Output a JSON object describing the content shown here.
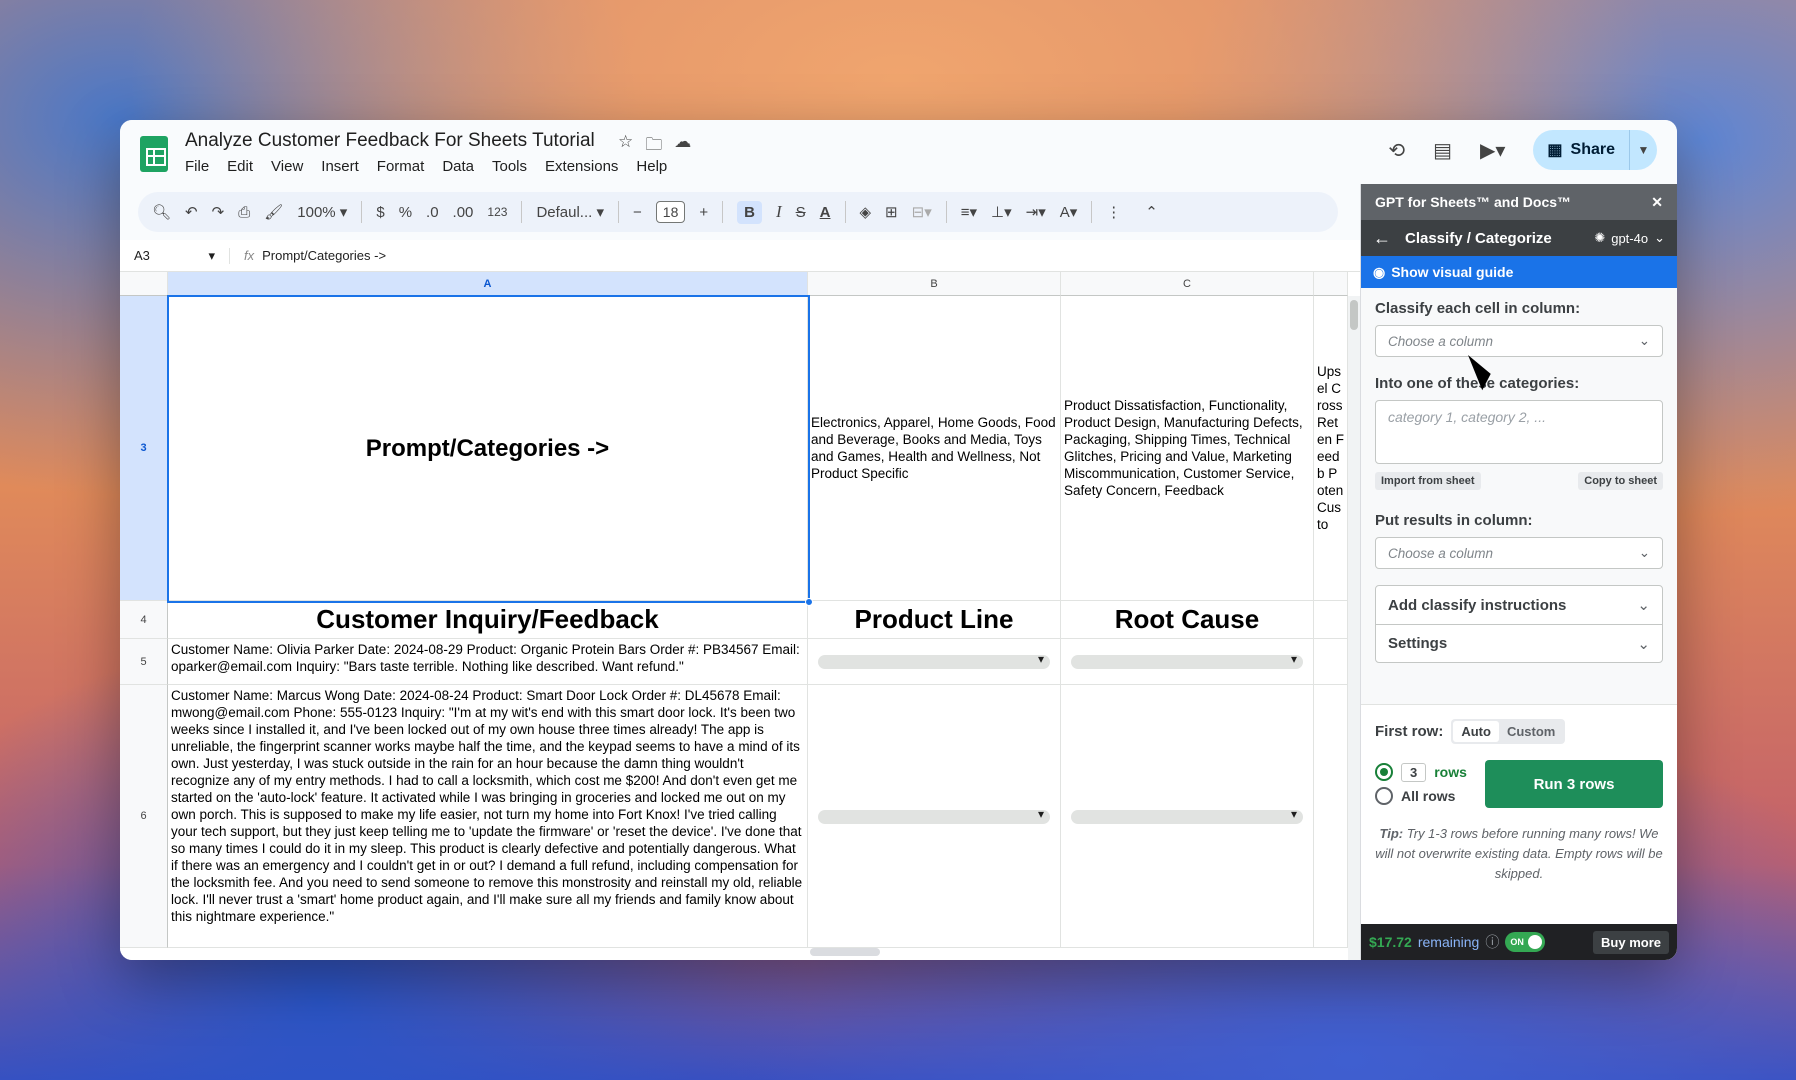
{
  "doc": {
    "title": "Analyze Customer Feedback For Sheets Tutorial",
    "menu": [
      "File",
      "Edit",
      "View",
      "Insert",
      "Format",
      "Data",
      "Tools",
      "Extensions",
      "Help"
    ],
    "share_label": "Share"
  },
  "toolbar": {
    "zoom": "100%",
    "currency": "$",
    "percent": "%",
    "dec_less": ".0",
    "dec_more": ".00",
    "number_format": "123",
    "font": "Defaul...",
    "font_size": "18",
    "bold": "B",
    "italic": "I"
  },
  "formula": {
    "cell_ref": "A3",
    "fx": "fx",
    "content": "Prompt/Categories ->"
  },
  "grid": {
    "columns": [
      "A",
      "B",
      "C"
    ],
    "rows": [
      "3",
      "4",
      "5",
      "6"
    ],
    "r3": {
      "a": "Prompt/Categories ->",
      "b": "Electronics, Apparel, Home Goods, Food and Beverage, Books and Media, Toys and Games, Health and Wellness, Not Product Specific",
      "c": "Product Dissatisfaction, Functionality, Product Design, Manufacturing Defects, Packaging, Shipping Times, Technical Glitches, Pricing and Value, Marketing Miscommunication, Customer Service, Safety Concern, Feedback",
      "d": "Upsel Cross Reten Feedb Poten Custo"
    },
    "r4": {
      "a": "Customer Inquiry/Feedback",
      "b": "Product Line",
      "c": "Root Cause"
    },
    "r5": {
      "a": "Customer Name: Olivia Parker Date: 2024-08-29 Product: Organic Protein Bars Order #: PB34567 Email: oparker@email.com Inquiry: \"Bars taste terrible. Nothing like described. Want refund.\""
    },
    "r6": {
      "a": "Customer Name: Marcus Wong Date: 2024-08-24 Product: Smart Door Lock Order #: DL45678 Email: mwong@email.com Phone: 555-0123 Inquiry: \"I'm at my wit's end with this smart door lock. It's been two weeks since I installed it, and I've been locked out of my own house three times already! The app is unreliable, the fingerprint scanner works maybe half the time, and the keypad seems to have a mind of its own. Just yesterday, I was stuck outside in the rain for an hour because the damn thing wouldn't recognize any of my entry methods. I had to call a locksmith, which cost me $200! And don't even get me started on the 'auto-lock' feature. It activated while I was bringing in groceries and locked me out on my own porch. This is supposed to make my life easier, not turn my home into Fort Knox! I've tried calling your tech support, but they just keep telling me to 'update the firmware' or 'reset the device'. I've done that so many times I could do it in my sleep. This product is clearly defective and potentially dangerous. What if there was an emergency and I couldn't get in or out? I demand a full refund, including compensation for the locksmith fee. And you need to send someone to remove this monstrosity and reinstall my old, reliable lock. I'll never trust a 'smart' home product again, and I'll make sure all my friends and family know about this nightmare experience.\""
    }
  },
  "panel": {
    "title": "GPT for Sheets™ and Docs™",
    "section": "Classify / Categorize",
    "model": "gpt-4o",
    "guide": "Show visual guide",
    "classify_label": "Classify each cell in column:",
    "choose_placeholder": "Choose a column",
    "categories_label": "Into one of these categories:",
    "categories_placeholder": "category 1, category 2, ...",
    "import_btn": "Import from sheet",
    "copy_btn": "Copy to sheet",
    "results_label": "Put results in column:",
    "results_placeholder": "Choose a column",
    "add_instructions": "Add classify instructions",
    "settings": "Settings",
    "first_row_label": "First row:",
    "auto": "Auto",
    "custom": "Custom",
    "rows_count": "3",
    "rows_word": "rows",
    "all_rows": "All rows",
    "run_btn": "Run 3 rows",
    "tip_label": "Tip:",
    "tip_text": "Try 1-3 rows before running many rows! We will not overwrite existing data. Empty rows will be skipped.",
    "balance": "$17.72",
    "remaining": "remaining",
    "toggle": "ON",
    "buy_more": "Buy more"
  },
  "colors": {
    "accent_blue": "#1a73e8",
    "run_green": "#1e8e5a",
    "share_bg": "#c2e7ff"
  }
}
